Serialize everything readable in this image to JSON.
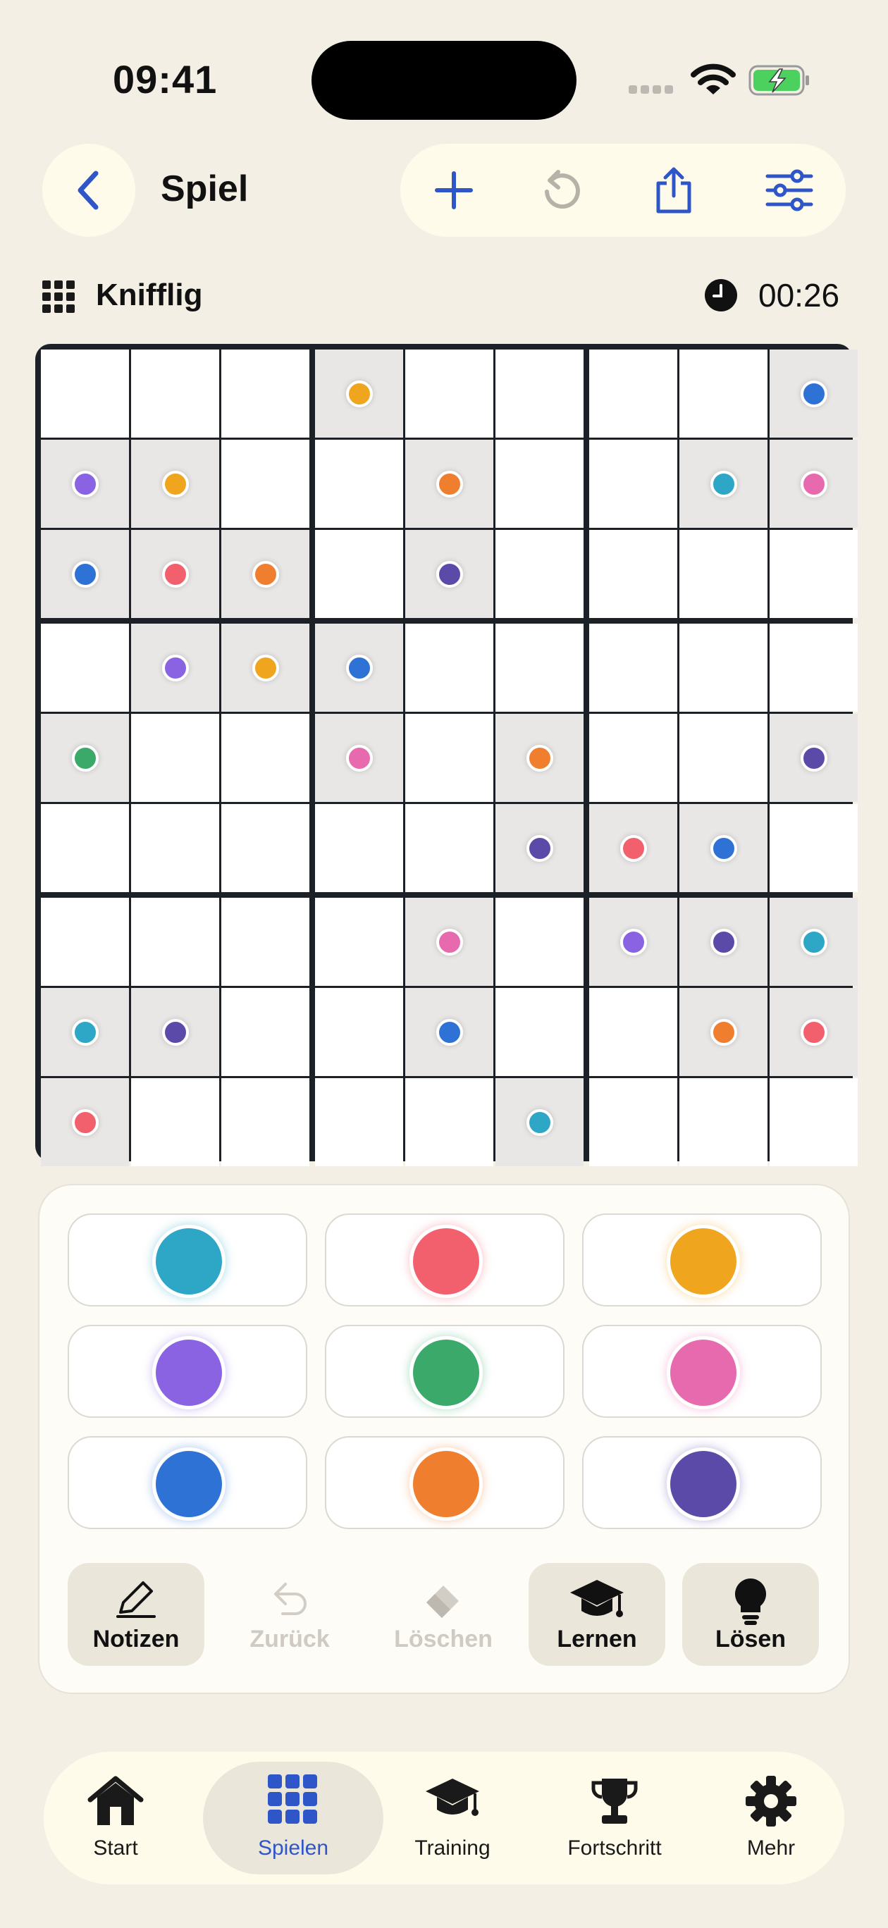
{
  "status_bar": {
    "time": "09:41"
  },
  "header": {
    "title": "Spiel",
    "back_icon": "chevron-left-icon",
    "tools": [
      {
        "name": "new-game-button",
        "icon": "plus-icon",
        "enabled": true
      },
      {
        "name": "restart-button",
        "icon": "rotate-ccw-icon",
        "enabled": false
      },
      {
        "name": "share-button",
        "icon": "share-icon",
        "enabled": true
      },
      {
        "name": "settings-button",
        "icon": "sliders-icon",
        "enabled": true
      }
    ]
  },
  "info": {
    "difficulty": "Knifflig",
    "timer": "00:26"
  },
  "colors": {
    "teal": "#2ea6c6",
    "red": "#f2606e",
    "yellow": "#f0a51e",
    "purple": "#8a63e3",
    "green": "#3ba96a",
    "pink": "#e86aae",
    "blue": "#2f72d6",
    "orange": "#ef7e2f",
    "indigo": "#5c4aa8"
  },
  "board": {
    "cells": [
      [
        null,
        null,
        null,
        "yellow",
        null,
        null,
        null,
        null,
        "blue"
      ],
      [
        "purple",
        "yellow",
        null,
        null,
        "orange",
        null,
        null,
        "teal",
        "pink"
      ],
      [
        "blue",
        "red",
        "orange",
        null,
        "indigo",
        null,
        null,
        null,
        null
      ],
      [
        null,
        "purple",
        "yellow",
        "blue",
        null,
        null,
        null,
        null,
        null
      ],
      [
        "green",
        null,
        null,
        "pink",
        null,
        "orange",
        null,
        null,
        "indigo"
      ],
      [
        null,
        null,
        null,
        null,
        null,
        "indigo",
        "red",
        "blue",
        null
      ],
      [
        null,
        null,
        null,
        null,
        "pink",
        null,
        "purple",
        "indigo",
        "teal"
      ],
      [
        "teal",
        "indigo",
        null,
        null,
        "blue",
        null,
        null,
        "orange",
        "red"
      ],
      [
        "red",
        null,
        null,
        null,
        null,
        "teal",
        null,
        null,
        null
      ]
    ]
  },
  "palette": [
    "teal",
    "red",
    "yellow",
    "purple",
    "green",
    "pink",
    "blue",
    "orange",
    "indigo"
  ],
  "actions": [
    {
      "label": "Notizen",
      "icon": "pencil-icon",
      "state": "active"
    },
    {
      "label": "Zurück",
      "icon": "undo-icon",
      "state": "disabled"
    },
    {
      "label": "Löschen",
      "icon": "eraser-icon",
      "state": "disabled"
    },
    {
      "label": "Lernen",
      "icon": "graduation-cap-icon",
      "state": "active"
    },
    {
      "label": "Lösen",
      "icon": "lightbulb-icon",
      "state": "active"
    }
  ],
  "tabs": [
    {
      "label": "Start",
      "icon": "house-icon",
      "selected": false
    },
    {
      "label": "Spielen",
      "icon": "grid-icon",
      "selected": true
    },
    {
      "label": "Training",
      "icon": "graduation-cap-icon",
      "selected": false
    },
    {
      "label": "Fortschritt",
      "icon": "trophy-icon",
      "selected": false
    },
    {
      "label": "Mehr",
      "icon": "gear-icon",
      "selected": false
    }
  ]
}
